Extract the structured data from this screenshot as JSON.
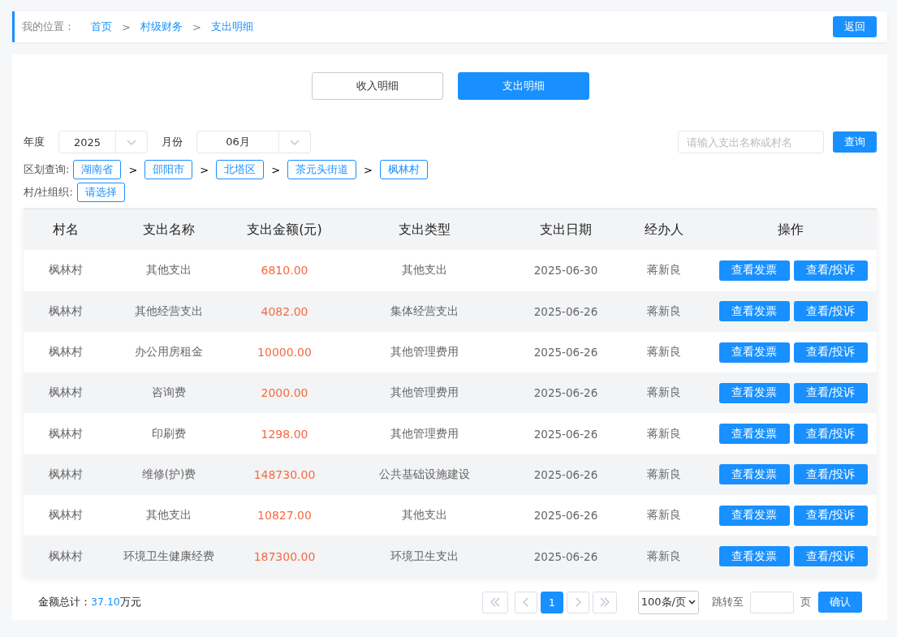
{
  "breadcrumb": {
    "label": "我的位置：",
    "items": [
      {
        "text": "首页"
      },
      {
        "text": "村级财务"
      },
      {
        "text": "支出明细"
      }
    ],
    "separator": ">"
  },
  "back_button": "返回",
  "tabs": [
    {
      "label": "收入明细",
      "selected": false
    },
    {
      "label": "支出明细",
      "selected": true
    }
  ],
  "filters": {
    "year_label": "年度",
    "year": "2025",
    "month_label": "月份",
    "month": "06月",
    "search_placeholder": "请输入支出名称或村名",
    "search_button": "查询"
  },
  "region": {
    "label": "区划查询:",
    "separator": ">",
    "items": [
      "湖南省",
      "邵阳市",
      "北塔区",
      "茶元头街道",
      "枫林村"
    ]
  },
  "organization": {
    "label": "村/社组织:",
    "value": "请选择"
  },
  "table": {
    "columns": [
      "村名",
      "支出名称",
      "支出金额(元)",
      "支出类型",
      "支出日期",
      "经办人",
      "操作"
    ],
    "rows": [
      {
        "village": "枫林村",
        "name": "其他支出",
        "amount": "6810.00",
        "type": "其他支出",
        "date": "2025-06-30",
        "handler": "蒋新良",
        "actions": [
          "查看发票",
          "查看/投诉"
        ]
      },
      {
        "village": "枫林村",
        "name": "其他经营支出",
        "amount": "4082.00",
        "type": "集体经营支出",
        "date": "2025-06-26",
        "handler": "蒋新良",
        "actions": [
          "查看发票",
          "查看/投诉"
        ]
      },
      {
        "village": "枫林村",
        "name": "办公用房租金",
        "amount": "10000.00",
        "type": "其他管理费用",
        "date": "2025-06-26",
        "handler": "蒋新良",
        "actions": [
          "查看发票",
          "查看/投诉"
        ]
      },
      {
        "village": "枫林村",
        "name": "咨询费",
        "amount": "2000.00",
        "type": "其他管理费用",
        "date": "2025-06-26",
        "handler": "蒋新良",
        "actions": [
          "查看发票",
          "查看/投诉"
        ]
      },
      {
        "village": "枫林村",
        "name": "印刷费",
        "amount": "1298.00",
        "type": "其他管理费用",
        "date": "2025-06-26",
        "handler": "蒋新良",
        "actions": [
          "查看发票",
          "查看/投诉"
        ]
      },
      {
        "village": "枫林村",
        "name": "维修(护)费",
        "amount": "148730.00",
        "type": "公共基础设施建设",
        "date": "2025-06-26",
        "handler": "蒋新良",
        "actions": [
          "查看发票",
          "查看/投诉"
        ]
      },
      {
        "village": "枫林村",
        "name": "其他支出",
        "amount": "10827.00",
        "type": "其他支出",
        "date": "2025-06-26",
        "handler": "蒋新良",
        "actions": [
          "查看发票",
          "查看/投诉"
        ]
      },
      {
        "village": "枫林村",
        "name": "环境卫生健康经费",
        "amount": "187300.00",
        "type": "环境卫生支出",
        "date": "2025-06-26",
        "handler": "蒋新良",
        "actions": [
          "查看发票",
          "查看/投诉"
        ]
      }
    ]
  },
  "footer": {
    "total_label": "金额总计：",
    "total_value": "37.10",
    "total_unit": "万元",
    "pages": [
      {
        "label": "1",
        "selected": true
      }
    ],
    "page_size": "100条/页",
    "jump_label": "跳转至",
    "page_unit": "页",
    "confirm_button": "确认"
  }
}
